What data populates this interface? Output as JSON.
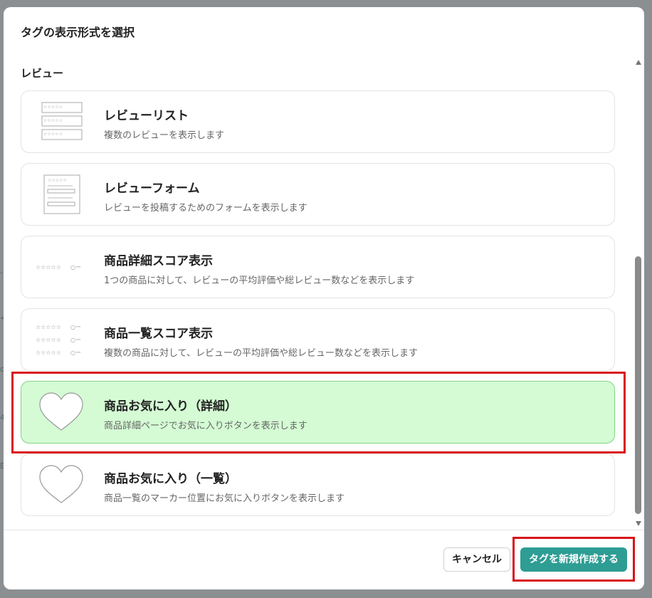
{
  "modal": {
    "title": "タグの表示形式を選択",
    "section_label": "レビュー"
  },
  "options": [
    {
      "title": "レビューリスト",
      "desc": "複数のレビューを表示します",
      "selected": false
    },
    {
      "title": "レビューフォーム",
      "desc": "レビューを投稿するためのフォームを表示します",
      "selected": false
    },
    {
      "title": "商品詳細スコア表示",
      "desc": "1つの商品に対して、レビューの平均評価や総レビュー数などを表示します",
      "selected": false
    },
    {
      "title": "商品一覧スコア表示",
      "desc": "複数の商品に対して、レビューの平均評価や総レビュー数などを表示します",
      "selected": false
    },
    {
      "title": "商品お気に入り（詳細）",
      "desc": "商品詳細ページでお気に入りボタンを表示します",
      "selected": true
    },
    {
      "title": "商品お気に入り（一覧）",
      "desc": "商品一覧のマーカー位置にお気に入りボタンを表示します",
      "selected": false
    }
  ],
  "thumbnails": {
    "stars": "☆☆☆☆☆",
    "circle_dash": "○ー"
  },
  "footer": {
    "cancel_label": "キャンセル",
    "create_label": "タグを新規作成する"
  },
  "colors": {
    "selected_bg": "#d4fbd4",
    "primary_button": "#2e9d94",
    "highlight": "#d9141b"
  },
  "icons": [
    "review-list-icon",
    "review-form-icon",
    "star-score-icon",
    "star-score-list-icon",
    "heart-icon"
  ]
}
